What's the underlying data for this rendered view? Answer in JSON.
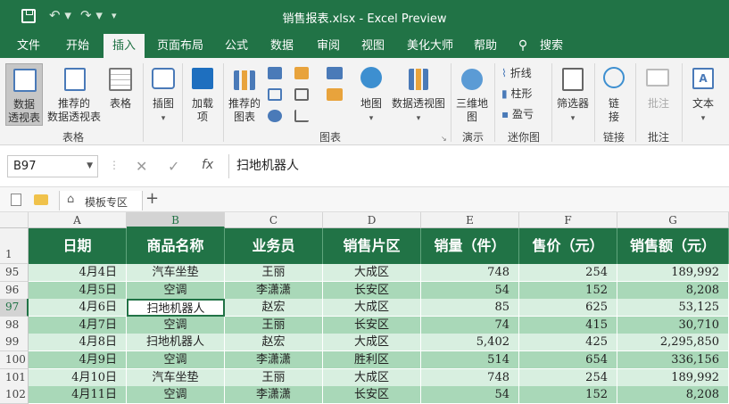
{
  "window": {
    "title": "销售报表.xlsx  -  Excel Preview"
  },
  "menu": [
    "文件",
    "开始",
    "插入",
    "页面布局",
    "公式",
    "数据",
    "审阅",
    "视图",
    "美化大师",
    "帮助",
    "搜索"
  ],
  "ribbon": {
    "pivot": "数据\n透视表",
    "recommend": "推荐的\n数据透视表",
    "table": "表格",
    "illustrations": "插图",
    "addins": "加载\n项",
    "rec_charts": "推荐的\n图表",
    "maps": "地图",
    "pivotchart": "数据透视图",
    "map3d": "三维地\n图",
    "line": "折线",
    "column": "柱形",
    "winloss": "盈亏",
    "slicer": "筛选器",
    "link": "链\n接",
    "comment": "批注",
    "text": "文本",
    "groups": {
      "tables": "表格",
      "charts": "图表",
      "tours": "演示",
      "sparklines": "迷你图",
      "links": "链接",
      "comments": "批注"
    }
  },
  "namebox": "B97",
  "formula": "扫地机器人",
  "sheettab": "模板专区",
  "columns": [
    "A",
    "B",
    "C",
    "D",
    "E",
    "F",
    "G"
  ],
  "headers": [
    "日期",
    "商品名称",
    "业务员",
    "销售片区",
    "销量（件）",
    "售价（元）",
    "销售额（元）"
  ],
  "rows": [
    {
      "n": "95",
      "date": "4月4日",
      "item": "汽车坐垫",
      "rep": "王丽",
      "area": "大成区",
      "qty": "748",
      "price": "254",
      "total": "189,992"
    },
    {
      "n": "96",
      "date": "4月5日",
      "item": "空调",
      "rep": "李潇潇",
      "area": "长安区",
      "qty": "54",
      "price": "152",
      "total": "8,208"
    },
    {
      "n": "97",
      "date": "4月6日",
      "item": "扫地机器人",
      "rep": "赵宏",
      "area": "大成区",
      "qty": "85",
      "price": "625",
      "total": "53,125"
    },
    {
      "n": "98",
      "date": "4月7日",
      "item": "空调",
      "rep": "王丽",
      "area": "长安区",
      "qty": "74",
      "price": "415",
      "total": "30,710"
    },
    {
      "n": "99",
      "date": "4月8日",
      "item": "扫地机器人",
      "rep": "赵宏",
      "area": "大成区",
      "qty": "5,402",
      "price": "425",
      "total": "2,295,850"
    },
    {
      "n": "100",
      "date": "4月9日",
      "item": "空调",
      "rep": "李潇潇",
      "area": "胜利区",
      "qty": "514",
      "price": "654",
      "total": "336,156"
    },
    {
      "n": "101",
      "date": "4月10日",
      "item": "汽车坐垫",
      "rep": "王丽",
      "area": "大成区",
      "qty": "748",
      "price": "254",
      "total": "189,992"
    },
    {
      "n": "102",
      "date": "4月11日",
      "item": "空调",
      "rep": "李潇潇",
      "area": "长安区",
      "qty": "54",
      "price": "152",
      "total": "8,208"
    }
  ],
  "colors": {
    "brand": "#217346",
    "stripe_dark": "#a9d8b8",
    "stripe_light": "#d8efe0"
  }
}
